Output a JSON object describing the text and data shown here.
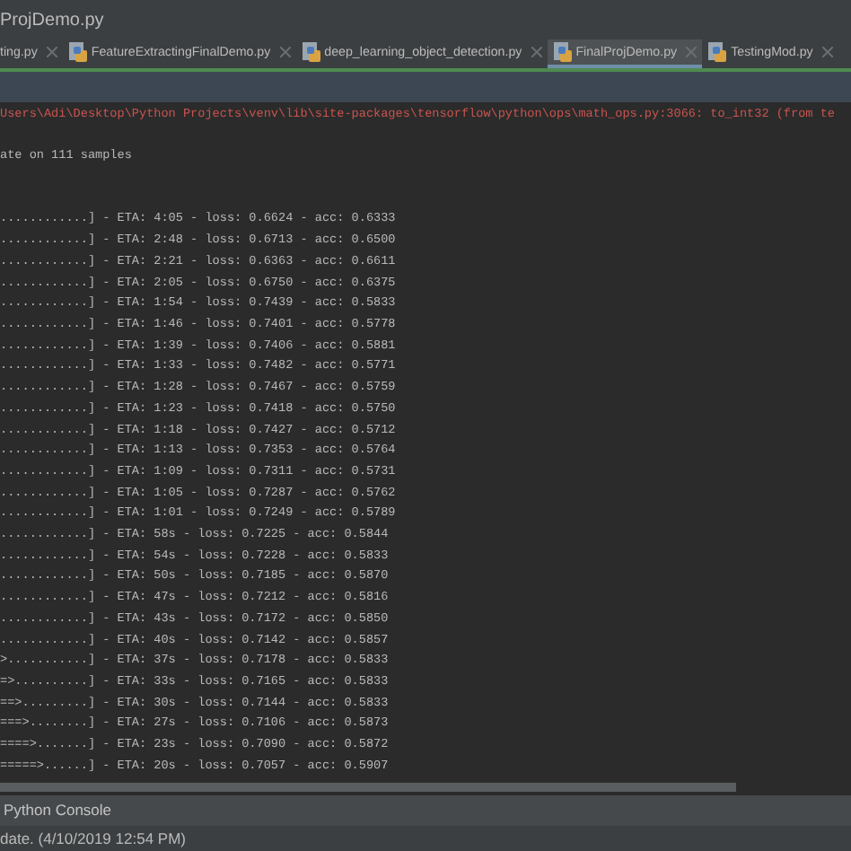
{
  "window": {
    "title": "ProjDemo.py"
  },
  "tabs": [
    {
      "label": "ting.py",
      "selected": false
    },
    {
      "label": "FeatureExtractingFinalDemo.py",
      "selected": false
    },
    {
      "label": "deep_learning_object_detection.py",
      "selected": false
    },
    {
      "label": "FinalProjDemo.py",
      "selected": true
    },
    {
      "label": "TestingMod.py",
      "selected": false
    }
  ],
  "console": {
    "lines": [
      {
        "kind": "error",
        "text": "Users\\Adi\\Desktop\\Python Projects\\venv\\lib\\site-packages\\tensorflow\\python\\ops\\math_ops.py:3066: to_int32 (from te"
      },
      {
        "kind": "blank"
      },
      {
        "kind": "output",
        "text": "ate on 111 samples"
      },
      {
        "kind": "blank"
      },
      {
        "kind": "blank"
      },
      {
        "kind": "output",
        "text": "............] - ETA: 4:05 - loss: 0.6624 - acc: 0.6333"
      },
      {
        "kind": "output",
        "text": "............] - ETA: 2:48 - loss: 0.6713 - acc: 0.6500"
      },
      {
        "kind": "output",
        "text": "............] - ETA: 2:21 - loss: 0.6363 - acc: 0.6611"
      },
      {
        "kind": "output",
        "text": "............] - ETA: 2:05 - loss: 0.6750 - acc: 0.6375"
      },
      {
        "kind": "output",
        "text": "............] - ETA: 1:54 - loss: 0.7439 - acc: 0.5833"
      },
      {
        "kind": "output",
        "text": "............] - ETA: 1:46 - loss: 0.7401 - acc: 0.5778"
      },
      {
        "kind": "output",
        "text": "............] - ETA: 1:39 - loss: 0.7406 - acc: 0.5881"
      },
      {
        "kind": "output",
        "text": "............] - ETA: 1:33 - loss: 0.7482 - acc: 0.5771"
      },
      {
        "kind": "output",
        "text": "............] - ETA: 1:28 - loss: 0.7467 - acc: 0.5759"
      },
      {
        "kind": "output",
        "text": "............] - ETA: 1:23 - loss: 0.7418 - acc: 0.5750"
      },
      {
        "kind": "output",
        "text": "............] - ETA: 1:18 - loss: 0.7427 - acc: 0.5712"
      },
      {
        "kind": "output",
        "text": "............] - ETA: 1:13 - loss: 0.7353 - acc: 0.5764"
      },
      {
        "kind": "output",
        "text": "............] - ETA: 1:09 - loss: 0.7311 - acc: 0.5731"
      },
      {
        "kind": "output",
        "text": "............] - ETA: 1:05 - loss: 0.7287 - acc: 0.5762"
      },
      {
        "kind": "output",
        "text": "............] - ETA: 1:01 - loss: 0.7249 - acc: 0.5789"
      },
      {
        "kind": "output",
        "text": "............] - ETA: 58s - loss: 0.7225 - acc: 0.5844"
      },
      {
        "kind": "output",
        "text": "............] - ETA: 54s - loss: 0.7228 - acc: 0.5833"
      },
      {
        "kind": "output",
        "text": "............] - ETA: 50s - loss: 0.7185 - acc: 0.5870"
      },
      {
        "kind": "output",
        "text": "............] - ETA: 47s - loss: 0.7212 - acc: 0.5816"
      },
      {
        "kind": "output",
        "text": "............] - ETA: 43s - loss: 0.7172 - acc: 0.5850"
      },
      {
        "kind": "output",
        "text": "............] - ETA: 40s - loss: 0.7142 - acc: 0.5857"
      },
      {
        "kind": "output",
        "text": ">...........] - ETA: 37s - loss: 0.7178 - acc: 0.5833"
      },
      {
        "kind": "output",
        "text": "=>..........] - ETA: 33s - loss: 0.7165 - acc: 0.5833"
      },
      {
        "kind": "output",
        "text": "==>.........] - ETA: 30s - loss: 0.7144 - acc: 0.5833"
      },
      {
        "kind": "output",
        "text": "===>........] - ETA: 27s - loss: 0.7106 - acc: 0.5873"
      },
      {
        "kind": "output",
        "text": "====>.......] - ETA: 23s - loss: 0.7090 - acc: 0.5872"
      },
      {
        "kind": "output",
        "text": "=====>......] - ETA: 20s - loss: 0.7057 - acc: 0.5907"
      }
    ]
  },
  "tool_window": {
    "title": "Python Console"
  },
  "status_bar": {
    "text": "date. (4/10/2019 12:54 PM)"
  }
}
